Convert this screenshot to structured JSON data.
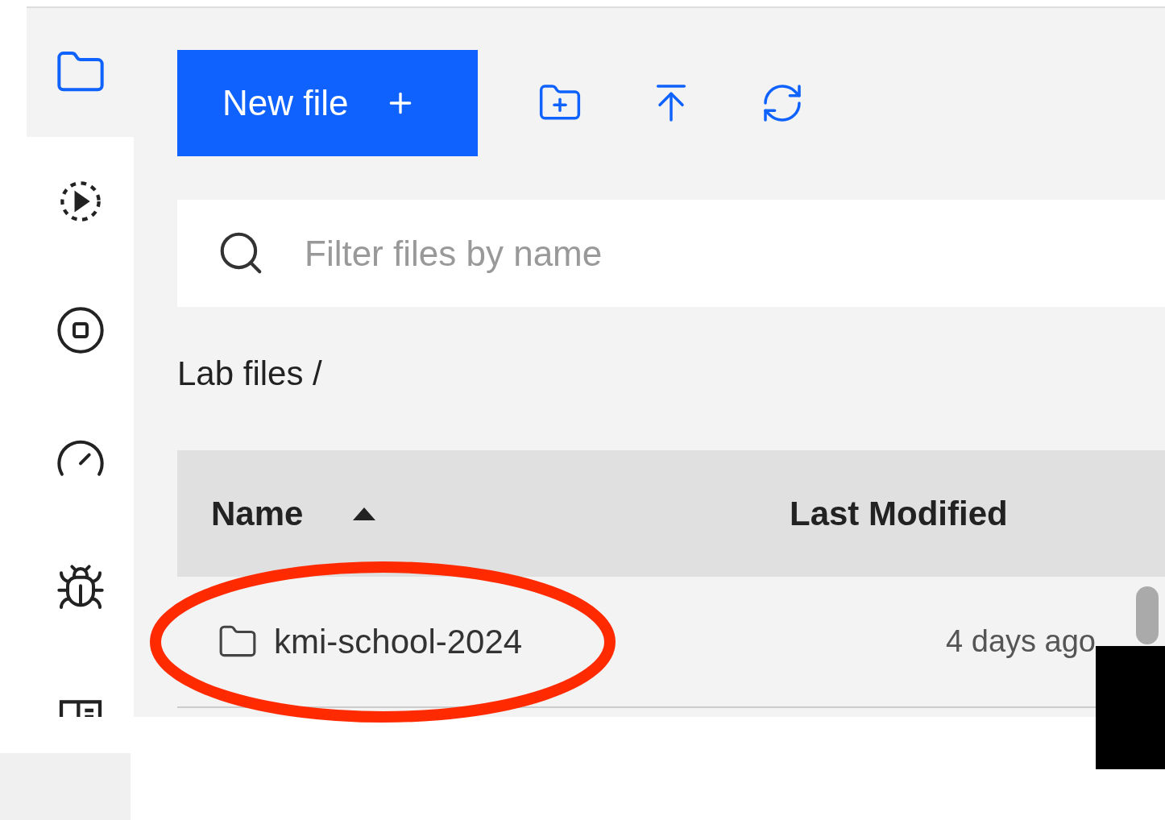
{
  "sidebar": {
    "items": [
      {
        "kind": "folder",
        "selected": true
      },
      {
        "kind": "running",
        "selected": false
      },
      {
        "kind": "stop",
        "selected": false
      },
      {
        "kind": "gauge",
        "selected": false
      },
      {
        "kind": "bug",
        "selected": false
      },
      {
        "kind": "contents",
        "selected": false
      }
    ]
  },
  "toolbar": {
    "new_file": "New file",
    "icons": [
      {
        "kind": "new-folder"
      },
      {
        "kind": "upload"
      },
      {
        "kind": "refresh"
      }
    ]
  },
  "search": {
    "placeholder": "Filter files by name"
  },
  "breadcrumb": "Lab files /",
  "table": {
    "columns": [
      {
        "label": "Name",
        "sorted": true
      },
      {
        "label": "Last Modified",
        "sorted": false
      }
    ],
    "rows": [
      {
        "kind": "folder",
        "name": "kmi-school-2024",
        "modified": "4 days ago"
      }
    ]
  }
}
